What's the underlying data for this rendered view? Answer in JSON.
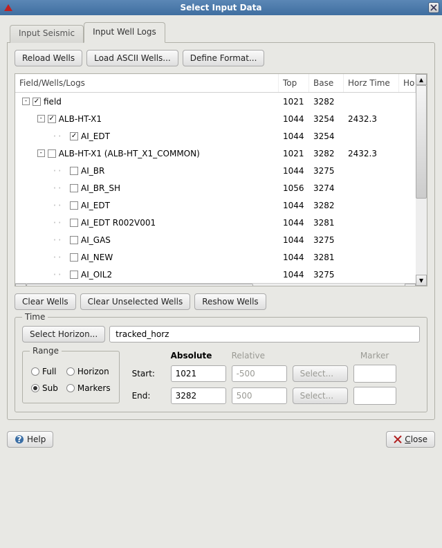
{
  "title": "Select Input Data",
  "tabs": {
    "seismic": "Input Seismic",
    "well_logs": "Input Well Logs"
  },
  "top_buttons": {
    "reload": "Reload Wells",
    "load_ascii": "Load ASCII Wells...",
    "define_format": "Define Format..."
  },
  "columns": {
    "name": "Field/Wells/Logs",
    "top": "Top",
    "base": "Base",
    "horz": "Horz Time",
    "extra": "Ho"
  },
  "tree": [
    {
      "indent": 0,
      "exp": "-",
      "chk": true,
      "label": "field",
      "top": "1021",
      "base": "3282",
      "horz": ""
    },
    {
      "indent": 1,
      "exp": "-",
      "chk": true,
      "label": "ALB-HT-X1",
      "top": "1044",
      "base": "3254",
      "horz": "2432.3"
    },
    {
      "indent": 2,
      "exp": "",
      "chk": true,
      "label": "AI_EDT",
      "top": "1044",
      "base": "3254",
      "horz": ""
    },
    {
      "indent": 1,
      "exp": "-",
      "chk": false,
      "label": "ALB-HT-X1 (ALB-HT_X1_COMMON)",
      "top": "1021",
      "base": "3282",
      "horz": "2432.3"
    },
    {
      "indent": 2,
      "exp": "",
      "chk": false,
      "label": "AI_BR",
      "top": "1044",
      "base": "3275",
      "horz": ""
    },
    {
      "indent": 2,
      "exp": "",
      "chk": false,
      "label": "AI_BR_SH",
      "top": "1056",
      "base": "3274",
      "horz": ""
    },
    {
      "indent": 2,
      "exp": "",
      "chk": false,
      "label": "AI_EDT",
      "top": "1044",
      "base": "3282",
      "horz": ""
    },
    {
      "indent": 2,
      "exp": "",
      "chk": false,
      "label": "AI_EDT R002V001",
      "top": "1044",
      "base": "3281",
      "horz": ""
    },
    {
      "indent": 2,
      "exp": "",
      "chk": false,
      "label": "AI_GAS",
      "top": "1044",
      "base": "3275",
      "horz": ""
    },
    {
      "indent": 2,
      "exp": "",
      "chk": false,
      "label": "AI_NEW",
      "top": "1044",
      "base": "3281",
      "horz": ""
    },
    {
      "indent": 2,
      "exp": "",
      "chk": false,
      "label": "AI_OIL2",
      "top": "1044",
      "base": "3275",
      "horz": ""
    }
  ],
  "mid_buttons": {
    "clear": "Clear Wells",
    "clear_unsel": "Clear Unselected Wells",
    "reshow": "Reshow Wells"
  },
  "time": {
    "title": "Time",
    "select_horizon": "Select Horizon...",
    "horizon_value": "tracked_horz",
    "range": {
      "title": "Range",
      "full": "Full",
      "horizon": "Horizon",
      "sub": "Sub",
      "markers": "Markers",
      "selected": "sub"
    },
    "cols": {
      "absolute": "Absolute",
      "relative": "Relative",
      "marker": "Marker"
    },
    "start_label": "Start:",
    "end_label": "End:",
    "start_abs": "1021",
    "start_rel": "-500",
    "end_abs": "3282",
    "end_rel": "500",
    "select_btn": "Select..."
  },
  "footer": {
    "help": "Help",
    "close": "Close"
  }
}
